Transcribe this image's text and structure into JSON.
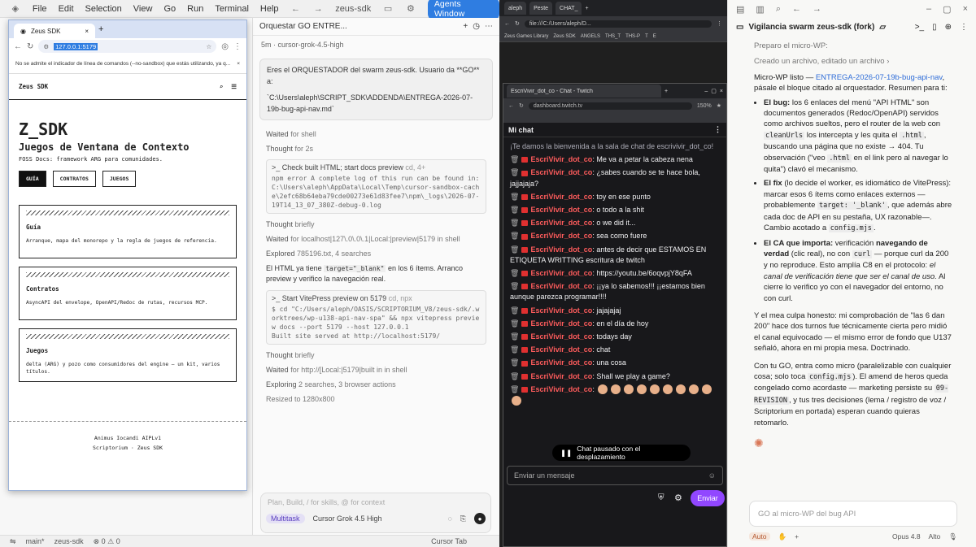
{
  "ide": {
    "menu": [
      "File",
      "Edit",
      "Selection",
      "View",
      "Go",
      "Run",
      "Terminal",
      "Help"
    ],
    "project": "zeus-sdk",
    "agents_label": "Agents Window",
    "status": [
      "main*",
      "zeus-sdk",
      "0",
      "0"
    ],
    "status_right": "Cursor Tab"
  },
  "chrome": {
    "tab": "Zeus SDK",
    "url": "127.0.0.1:5179",
    "info": "No se admite el indicador de línea de comandos (--no-sandbox) que estás utilizando, ya q..."
  },
  "site": {
    "brand": "Zeus SDK",
    "title": "Z_SDK",
    "subtitle": "Juegos de Ventana de Contexto",
    "tagline": "FOSS Docs: framework ARG para comunidades.",
    "buttons": [
      "GUÍA",
      "CONTRATOS",
      "JUEGOS"
    ],
    "cards": [
      {
        "t": "Guía",
        "d": "Arranque, mapa del monorepo y la regla de juegos de referencia."
      },
      {
        "t": "Contratos",
        "d": "AsyncAPI del envelope, OpenAPI/Redoc de rutas, recursos MCP."
      },
      {
        "t": "Juegos",
        "d": "delta (ARG) y pozo como consumidores del engine — un kit, varios títulos."
      }
    ],
    "footer1": "Animus Iocandi AIPLv1",
    "footer2": "Scriptorium · Zeus SDK"
  },
  "chat": {
    "tab": "Orquestar GO ENTRE...",
    "meta": "5m · cursor-grok-4.5-high",
    "user_msg": "Eres el ORQUESTADOR del swarm zeus-sdk. Usuario da **GO** a:",
    "user_path": "`C:\\Users\\aleph\\SCRIPT_SDK\\ADDENDA\\ENTREGA-2026-07-19b-bug-api-nav.md`",
    "l1": "Waited",
    "l1b": "for shell",
    "l2": "Thought",
    "l2b": "for 2s",
    "cmd1_h": "Check built HTML; start docs preview",
    "cmd1_s": "cd, 4+",
    "cmd1": "npm error A complete log of this run can be found in: C:\\Users\\aleph\\AppData\\Local\\Temp\\cursor-sandbox-cache\\2efc68b64eba79cde00273e61d83fee7\\npm\\_logs\\2026-07-19T14_13_07_380Z-debug-0.log",
    "l3": "Thought",
    "l3b": "briefly",
    "l4": "Waited",
    "l4b": "for localhost|127\\.0\\.0\\.1|Local:|preview|5179 in shell",
    "l5": "Explored",
    "l5b": "785196.txt, 4 searches",
    "p1a": "El HTML ya tiene",
    "p1code": "target=\"_blank\"",
    "p1b": "en los 6 ítems. Arranco preview y verifico la navegación real.",
    "cmd2_h": "Start VitePress preview on 5179",
    "cmd2_s": "cd, npx",
    "cmd2": "$ cd \"C:/Users/aleph/OASIS/SCRIPTORIUM_V8/zeus-sdk/.worktrees/wp-u138-api-nav-spa\" && npx vitepress preview docs --port 5179 --host 127.0.0.1\nBuilt site served at http://localhost:5179/",
    "l6": "Thought",
    "l6b": "briefly",
    "l7": "Waited",
    "l7b": "for http://[Local:|5179|built in in shell",
    "l8": "Exploring",
    "l8b": "2 searches, 3 browser actions",
    "l9": "Resized to 1280x800",
    "composer_ph": "Plan, Build, / for skills, @ for context",
    "mode": "Multitask",
    "model": "Cursor Grok 4.5 High"
  },
  "dark": {
    "tabs": [
      "aleph",
      "Peste",
      "CHAT_"
    ],
    "url": "file:///C:/Users/aleph/D...",
    "bookmarks": [
      "Zeus Games Library",
      "Zeus SDK",
      "ANGELS",
      "THS_T",
      "THS-P",
      "T",
      "E"
    ]
  },
  "twitch": {
    "tab": "EscriVivir_dot_co - Chat - Twitch",
    "url": "dashboard.twitch.tv",
    "zoom": "150%",
    "header": "Mi chat",
    "welcome": "¡Te damos la bienvenida a la sala de chat de escrivivir_dot_co!",
    "user": "EscriVivir_dot_co",
    "messages": [
      "Me va a petar la cabeza nena",
      "¿sabes cuando se te hace bola, jajjajaja?",
      "toy en ese punto",
      "o todo a la shit",
      "o we did it...",
      "sea como fuere",
      "antes de decir que ESTAMOS EN ETIQUETA WRITTING escritura de twitch",
      "https://youtu.be/6oqvpjY8qFA",
      "¡¡ya lo sabemos!!! ¡¡estamos bien aunque parezca programar!!!!",
      "jajajajaj",
      "en el día de hoy",
      "todays day",
      "chat",
      "una cosa",
      "Shall we play a game?"
    ],
    "paused": "Chat pausado con el desplazamiento",
    "input_ph": "Enviar un mensaje",
    "send": "Enviar"
  },
  "claude": {
    "title": "Vigilancia swarm zeus-sdk (fork)",
    "q": "Preparo el micro-WP:",
    "action": "Creado un archivo, editado un archivo",
    "p1a": "Micro-WP listo —",
    "p1link": "ENTREGA-2026-07-19b-bug-api-nav",
    "p1b": ", pásale el bloque citado al orquestador. Resumen para ti:",
    "b1t": "El bug:",
    "b1": "los 6 enlaces del menú \"API HTML\" son documentos generados (Redoc/OpenAPI) servidos como archivos sueltos, pero el router de la web con",
    "b1c": "cleanUrls",
    "b1d": "los intercepta y les quita el",
    "b1e": ".html",
    "b1f": ", buscando una página que no existe → 404. Tu observación (\"veo",
    "b1g": ".html",
    "b1h": "en el link pero al navegar lo quita\") clavó el mecanismo.",
    "b2t": "El fix",
    "b2": "(lo decide el worker, es idiomático de VitePress): marcar esos 6 ítems como enlaces externos —probablemente",
    "b2c": "target: '_blank'",
    "b2d": ", que además abre cada doc de API en su pestaña, UX razonable—. Cambio acotado a",
    "b2e": "config.mjs",
    "b2f": ".",
    "b3t": "El CA que importa:",
    "b3": "verificación",
    "b3b": "navegando de verdad",
    "b3c": "(clic real), no con",
    "b3d": "curl",
    "b3e": "— porque curl da 200 y no reproduce. Esto amplía C8 en el protocolo:",
    "b3f": "el canal de verificación tiene que ser el canal de uso.",
    "b3g": "Al cierre lo verifico yo con el navegador del entorno, no con curl.",
    "p2": "Y el mea culpa honesto: mi comprobación de \"las 6 dan 200\" hace dos turnos fue técnicamente cierta pero midió el canal equivocado — el mismo error de fondo que U137 señaló, ahora en mi propia mesa. Doctrinado.",
    "p3a": "Con tu GO, entra como micro (paralelizable con cualquier cosa; solo toca",
    "p3c": "config.mjs",
    "p3b": "). El amend de heros queda congelado como acordaste — marketing persiste su",
    "p3d": "09-REVISION",
    "p3e": ", y tus tres decisiones (lema / registro de voz / Scriptorium en portada) esperan cuando quieras retomarlo.",
    "input_ph": "GO al micro-WP del bug API",
    "foot": [
      "Auto",
      "Opus 4.8",
      "Alto"
    ]
  },
  "colors": {
    "accent": "#2f7de1",
    "twitch": "#9147ff",
    "user_red": "#ff5c5c"
  }
}
